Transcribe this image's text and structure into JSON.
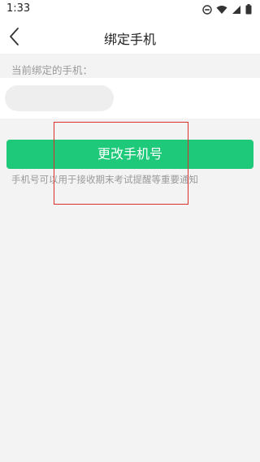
{
  "status_bar": {
    "time": "1:33",
    "icons": [
      "do-not-disturb-icon",
      "wifi-icon",
      "signal-icon",
      "battery-icon"
    ]
  },
  "navbar": {
    "back_icon": "chevron-left-icon",
    "title": "绑定手机"
  },
  "bound_phone": {
    "label": "当前绑定的手机：",
    "value_obscured": true
  },
  "actions": {
    "change_phone_label": "更改手机号"
  },
  "hint": {
    "text": "手机号可以用于接收期末考试提醒等重要通知"
  },
  "colors": {
    "accent": "#1fc97a",
    "highlight": "#d9302c",
    "background": "#f3f3f3"
  }
}
